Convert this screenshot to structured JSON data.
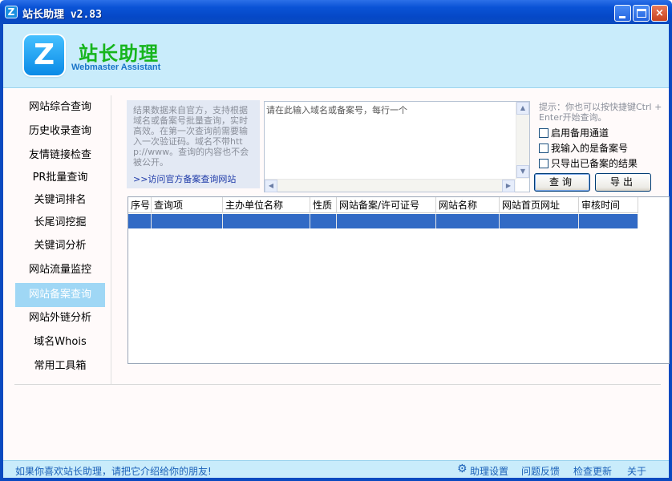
{
  "window": {
    "title": "站长助理 v2.83",
    "app_icon_glyph": "Z",
    "buttons": {
      "minimize": "minimize-icon",
      "maximize": "maximize-icon",
      "close": "×"
    }
  },
  "header": {
    "logo_glyph": "Z",
    "brand_cn": "站长助理",
    "brand_en": "Webmaster Assistant"
  },
  "sidebar": {
    "items": [
      {
        "label": "网站综合查询"
      },
      {
        "label": "历史收录查询"
      },
      {
        "label": "友情链接检查"
      },
      {
        "label": "PR批量查询"
      },
      {
        "label": "关键词排名"
      },
      {
        "label": "长尾词挖掘"
      },
      {
        "label": "关键词分析"
      },
      {
        "label": "网站流量监控"
      },
      {
        "label": "网站备案查询",
        "active": true
      },
      {
        "label": "网站外链分析"
      },
      {
        "label": "域名Whois"
      },
      {
        "label": "常用工具箱"
      }
    ]
  },
  "info": {
    "description": "结果数据来自官方，支持根据域名或备案号批量查询，实时高效。在第一次查询前需要输入一次验证码。域名不带http://www。查询的内容也不会被公开。",
    "link": ">>访问官方备案查询网站"
  },
  "input": {
    "placeholder": "请在此输入域名或备案号，每行一个",
    "value": ""
  },
  "options": {
    "hint": "提示：你也可以按快捷键Ctrl + Enter开始查询。",
    "checkboxes": [
      {
        "label": "启用备用通道",
        "checked": false
      },
      {
        "label": "我输入的是备案号",
        "checked": false
      },
      {
        "label": "只导出已备案的结果",
        "checked": false
      }
    ],
    "query_button": "查询",
    "export_button": "导出"
  },
  "grid": {
    "columns": [
      "序号",
      "查询项",
      "主办单位名称",
      "性质",
      "网站备案/许可证号",
      "网站名称",
      "网站首页网址",
      "审核时间"
    ],
    "rows": [
      [
        "",
        "",
        "",
        "",
        "",
        "",
        "",
        ""
      ]
    ],
    "selected_row_color": "#316ac5"
  },
  "status": {
    "message": "如果你喜欢站长助理，请把它介绍给你的朋友!",
    "links": [
      "助理设置",
      "问题反馈",
      "检查更新",
      "关于"
    ],
    "settings_icon": "gear-icon"
  },
  "colors": {
    "titlebar": "#0548c7",
    "header_bg": "#c9ecfb",
    "brand_green": "#17b51d",
    "active_nav": "#9fd7f5",
    "link_blue": "#1a60b8"
  }
}
